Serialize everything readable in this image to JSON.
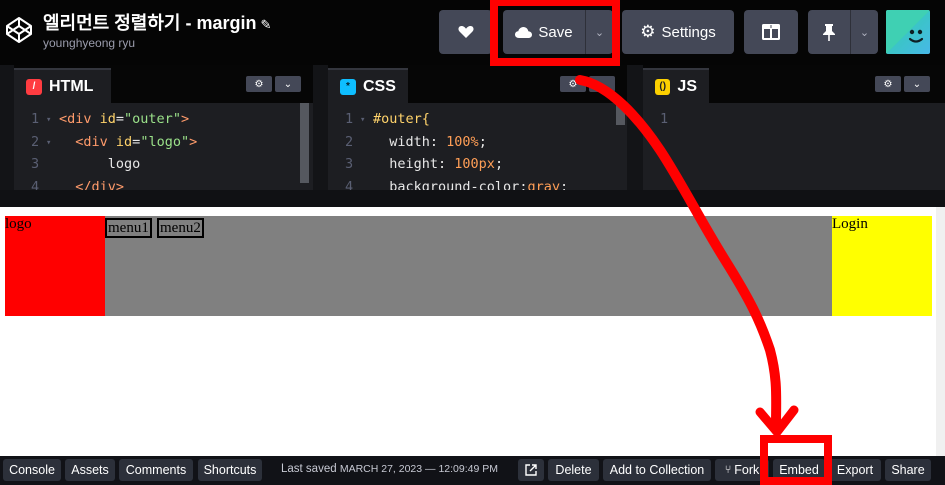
{
  "header": {
    "title": "엘리먼트 정렬하기 - margin",
    "author": "younghyeong ryu",
    "save_label": "Save",
    "settings_label": "Settings"
  },
  "editors": {
    "html": {
      "label": "HTML",
      "lines": [
        {
          "num": "1",
          "parts": [
            {
              "t": "<div ",
              "c": "tag"
            },
            {
              "t": "id",
              "c": "attr"
            },
            {
              "t": "=",
              "c": "prop"
            },
            {
              "t": "\"outer\"",
              "c": "str"
            },
            {
              "t": ">",
              "c": "tag"
            }
          ]
        },
        {
          "num": "2",
          "parts": [
            {
              "t": "  <div ",
              "c": "tag"
            },
            {
              "t": "id",
              "c": "attr"
            },
            {
              "t": "=",
              "c": "prop"
            },
            {
              "t": "\"logo\"",
              "c": "str"
            },
            {
              "t": ">",
              "c": "tag"
            }
          ]
        },
        {
          "num": "3",
          "parts": [
            {
              "t": "      logo",
              "c": "prop"
            }
          ]
        },
        {
          "num": "4",
          "parts": [
            {
              "t": "  </div>",
              "c": "tag"
            }
          ]
        }
      ]
    },
    "css": {
      "label": "CSS",
      "lines": [
        {
          "num": "1",
          "parts": [
            {
              "t": "#outer{",
              "c": "attr"
            }
          ]
        },
        {
          "num": "2",
          "parts": [
            {
              "t": "  width",
              "c": "prop"
            },
            {
              "t": ": ",
              "c": "prop"
            },
            {
              "t": "100%",
              "c": "val"
            },
            {
              "t": ";",
              "c": "prop"
            }
          ]
        },
        {
          "num": "3",
          "parts": [
            {
              "t": "  height",
              "c": "prop"
            },
            {
              "t": ": ",
              "c": "prop"
            },
            {
              "t": "100px",
              "c": "val"
            },
            {
              "t": ";",
              "c": "prop"
            }
          ]
        },
        {
          "num": "4",
          "parts": [
            {
              "t": "  background-color",
              "c": "prop"
            },
            {
              "t": ":",
              "c": "prop"
            },
            {
              "t": "gray",
              "c": "val"
            },
            {
              "t": ";",
              "c": "prop"
            }
          ]
        }
      ]
    },
    "js": {
      "label": "JS",
      "lines": [
        {
          "num": "1",
          "parts": []
        }
      ]
    }
  },
  "result": {
    "logo_text": "logo",
    "menu1": "menu1",
    "menu2": "menu2",
    "login_text": "Login"
  },
  "footer": {
    "console": "Console",
    "assets": "Assets",
    "comments": "Comments",
    "shortcuts": "Shortcuts",
    "saved_label": "Last saved",
    "saved_time": "MARCH 27, 2023 — 12:09:49 PM",
    "delete": "Delete",
    "add_collection": "Add to Collection",
    "fork": "Fork",
    "embed": "Embed",
    "export": "Export",
    "share": "Share"
  },
  "icons": {
    "logo": "codepen-logo-icon",
    "heart": "heart-icon",
    "save": "cloud-icon",
    "settings": "gear-icon",
    "layout": "layout-icon",
    "pin": "pin-icon",
    "chevron": "chevron-down-icon",
    "external": "external-link-icon",
    "fork": "fork-icon"
  },
  "colors": {
    "annotation": "#ff0000",
    "button": "#444857",
    "html_badge": "#ff3c41",
    "css_badge": "#0ebeff",
    "js_badge": "#fcd000"
  }
}
